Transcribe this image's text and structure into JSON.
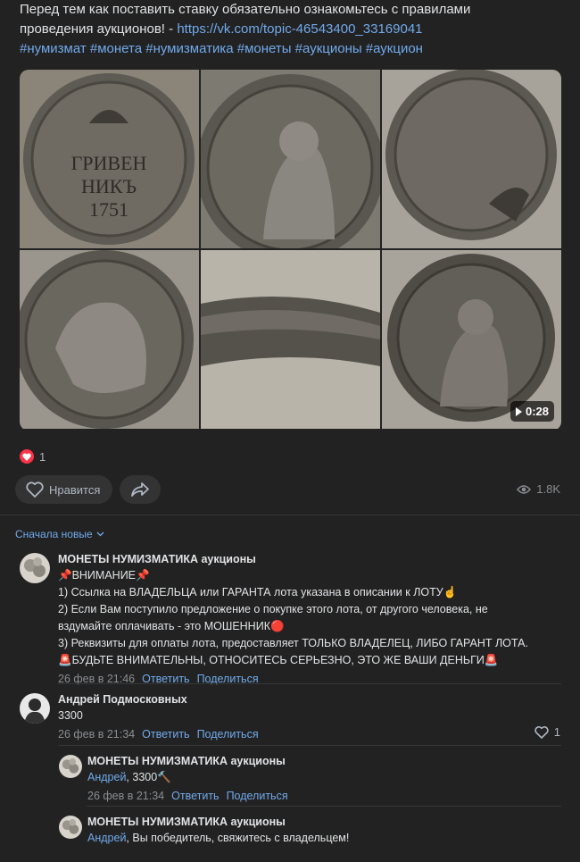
{
  "post": {
    "text_line1": "Перед тем как поставить ставку обязательно ознакомьтесь с правилами",
    "text_line2_prefix": "проведения аукционов! - ",
    "link": "https://vk.com/topic-46543400_33169041",
    "hashtags": "#нумизмат #монета #нумизматика #монеты #аукционы #аукцион"
  },
  "gallery": {
    "tile1_text": [
      "ГРИВЕН",
      "НИКЪ",
      "1751"
    ],
    "video_duration": "0:28"
  },
  "reactions": {
    "count": "1"
  },
  "actions": {
    "like_label": "Нравится",
    "views": "1.8K"
  },
  "comments_sort": "Сначала новые",
  "comments": [
    {
      "author": "МОНЕТЫ НУМИЗМАТИКА аукционы",
      "lines": [
        "📌ВНИМАНИЕ📌",
        "1) Ссылка на ВЛАДЕЛЬЦА или ГАРАНТА лота указана в описании к ЛОТУ☝",
        "2) Если Вам поступило предложение о покупке этого лота, от другого человека, не",
        "вздумайте оплачивать - это МОШЕННИК🔴",
        "3) Реквизиты для оплаты лота, предоставляет ТОЛЬКО ВЛАДЕЛЕЦ, ЛИБО ГАРАНТ ЛОТА.",
        "🚨БУДЬТЕ ВНИМАТЕЛЬНЫ, ОТНОСИТЕСЬ СЕРЬЕЗНО, ЭТО ЖЕ ВАШИ ДЕНЬГИ🚨"
      ],
      "date": "26 фев в 21:46",
      "reply": "Ответить",
      "share": "Поделиться"
    },
    {
      "author": "Андрей Подмосковных",
      "text": "3300",
      "date": "26 фев в 21:34",
      "reply": "Ответить",
      "share": "Поделиться",
      "likes": "1"
    },
    {
      "author": "МОНЕТЫ НУМИЗМАТИКА аукционы",
      "mention": "Андрей",
      "text": ", 3300🔨",
      "date": "26 фев в 21:34",
      "reply": "Ответить",
      "share": "Поделиться"
    },
    {
      "author": "МОНЕТЫ НУМИЗМАТИКА аукционы",
      "mention": "Андрей",
      "text": ", Вы победитель, свяжитесь с владельцем!"
    }
  ],
  "colors": {
    "link": "#71aaeb",
    "background": "#222222",
    "heart": "#ff3347"
  }
}
